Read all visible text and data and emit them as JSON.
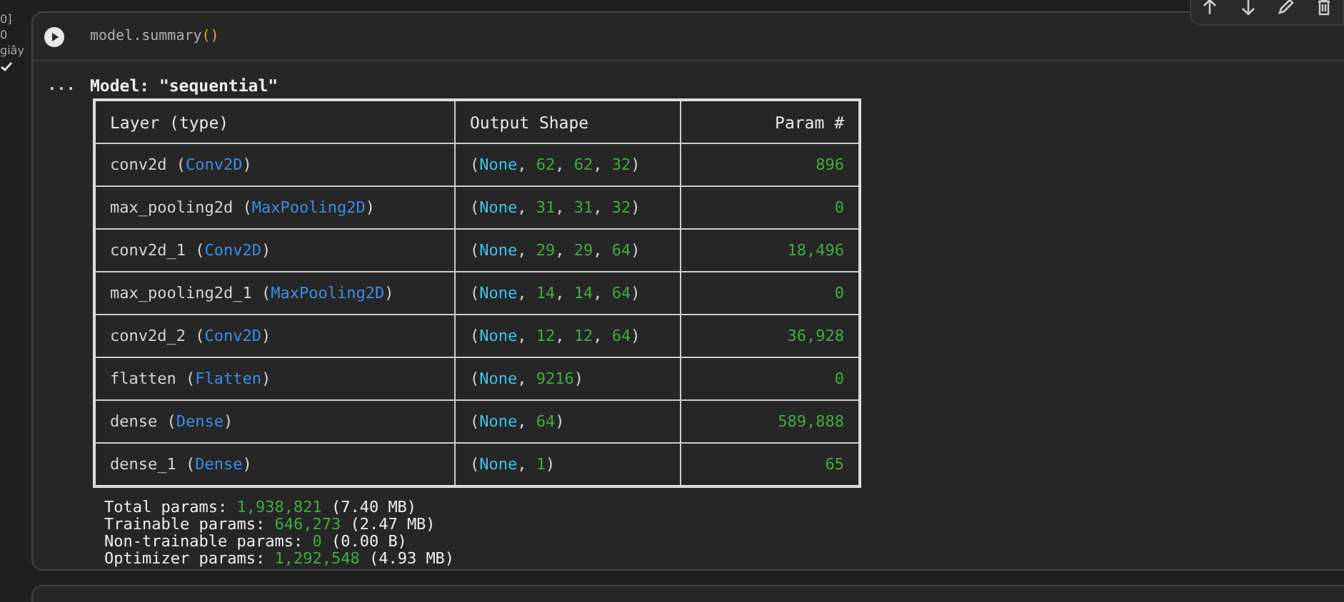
{
  "gutter": {
    "labels": [
      "0]",
      "0",
      "giây"
    ]
  },
  "cell": {
    "code": [
      {
        "kind": "fn",
        "text": "model.summary"
      },
      {
        "kind": "paren",
        "text": "()"
      }
    ],
    "output": {
      "prompt": "...",
      "title": "Model: \"sequential\"",
      "table": {
        "columns": [
          "Layer (type)",
          "Output Shape",
          "Param #"
        ],
        "rows": [
          {
            "layer": [
              {
                "kind": "t",
                "text": "conv2d ("
              },
              {
                "kind": "type",
                "text": "Conv2D"
              },
              {
                "kind": "t",
                "text": ")"
              }
            ],
            "shape": [
              {
                "kind": "t",
                "text": "("
              },
              {
                "kind": "none",
                "text": "None"
              },
              {
                "kind": "t",
                "text": ", "
              },
              {
                "kind": "num",
                "text": "62"
              },
              {
                "kind": "t",
                "text": ", "
              },
              {
                "kind": "num",
                "text": "62"
              },
              {
                "kind": "t",
                "text": ", "
              },
              {
                "kind": "num",
                "text": "32"
              },
              {
                "kind": "t",
                "text": ")"
              }
            ],
            "params": "896"
          },
          {
            "layer": [
              {
                "kind": "t",
                "text": "max_pooling2d ("
              },
              {
                "kind": "type",
                "text": "MaxPooling2D"
              },
              {
                "kind": "t",
                "text": ")"
              }
            ],
            "shape": [
              {
                "kind": "t",
                "text": "("
              },
              {
                "kind": "none",
                "text": "None"
              },
              {
                "kind": "t",
                "text": ", "
              },
              {
                "kind": "num",
                "text": "31"
              },
              {
                "kind": "t",
                "text": ", "
              },
              {
                "kind": "num",
                "text": "31"
              },
              {
                "kind": "t",
                "text": ", "
              },
              {
                "kind": "num",
                "text": "32"
              },
              {
                "kind": "t",
                "text": ")"
              }
            ],
            "params": "0"
          },
          {
            "layer": [
              {
                "kind": "t",
                "text": "conv2d_1 ("
              },
              {
                "kind": "type",
                "text": "Conv2D"
              },
              {
                "kind": "t",
                "text": ")"
              }
            ],
            "shape": [
              {
                "kind": "t",
                "text": "("
              },
              {
                "kind": "none",
                "text": "None"
              },
              {
                "kind": "t",
                "text": ", "
              },
              {
                "kind": "num",
                "text": "29"
              },
              {
                "kind": "t",
                "text": ", "
              },
              {
                "kind": "num",
                "text": "29"
              },
              {
                "kind": "t",
                "text": ", "
              },
              {
                "kind": "num",
                "text": "64"
              },
              {
                "kind": "t",
                "text": ")"
              }
            ],
            "params": "18,496"
          },
          {
            "layer": [
              {
                "kind": "t",
                "text": "max_pooling2d_1 ("
              },
              {
                "kind": "type",
                "text": "MaxPooling2D"
              },
              {
                "kind": "t",
                "text": ")"
              }
            ],
            "shape": [
              {
                "kind": "t",
                "text": "("
              },
              {
                "kind": "none",
                "text": "None"
              },
              {
                "kind": "t",
                "text": ", "
              },
              {
                "kind": "num",
                "text": "14"
              },
              {
                "kind": "t",
                "text": ", "
              },
              {
                "kind": "num",
                "text": "14"
              },
              {
                "kind": "t",
                "text": ", "
              },
              {
                "kind": "num",
                "text": "64"
              },
              {
                "kind": "t",
                "text": ")"
              }
            ],
            "params": "0"
          },
          {
            "layer": [
              {
                "kind": "t",
                "text": "conv2d_2 ("
              },
              {
                "kind": "type",
                "text": "Conv2D"
              },
              {
                "kind": "t",
                "text": ")"
              }
            ],
            "shape": [
              {
                "kind": "t",
                "text": "("
              },
              {
                "kind": "none",
                "text": "None"
              },
              {
                "kind": "t",
                "text": ", "
              },
              {
                "kind": "num",
                "text": "12"
              },
              {
                "kind": "t",
                "text": ", "
              },
              {
                "kind": "num",
                "text": "12"
              },
              {
                "kind": "t",
                "text": ", "
              },
              {
                "kind": "num",
                "text": "64"
              },
              {
                "kind": "t",
                "text": ")"
              }
            ],
            "params": "36,928"
          },
          {
            "layer": [
              {
                "kind": "t",
                "text": "flatten ("
              },
              {
                "kind": "type",
                "text": "Flatten"
              },
              {
                "kind": "t",
                "text": ")"
              }
            ],
            "shape": [
              {
                "kind": "t",
                "text": "("
              },
              {
                "kind": "none",
                "text": "None"
              },
              {
                "kind": "t",
                "text": ", "
              },
              {
                "kind": "num",
                "text": "9216"
              },
              {
                "kind": "t",
                "text": ")"
              }
            ],
            "params": "0"
          },
          {
            "layer": [
              {
                "kind": "t",
                "text": "dense ("
              },
              {
                "kind": "type",
                "text": "Dense"
              },
              {
                "kind": "t",
                "text": ")"
              }
            ],
            "shape": [
              {
                "kind": "t",
                "text": "("
              },
              {
                "kind": "none",
                "text": "None"
              },
              {
                "kind": "t",
                "text": ", "
              },
              {
                "kind": "num",
                "text": "64"
              },
              {
                "kind": "t",
                "text": ")"
              }
            ],
            "params": "589,888"
          },
          {
            "layer": [
              {
                "kind": "t",
                "text": "dense_1 ("
              },
              {
                "kind": "type",
                "text": "Dense"
              },
              {
                "kind": "t",
                "text": ")"
              }
            ],
            "shape": [
              {
                "kind": "t",
                "text": "("
              },
              {
                "kind": "none",
                "text": "None"
              },
              {
                "kind": "t",
                "text": ", "
              },
              {
                "kind": "num",
                "text": "1"
              },
              {
                "kind": "t",
                "text": ")"
              }
            ],
            "params": "65"
          }
        ]
      },
      "totals": [
        {
          "label": "Total params:",
          "value": "1,938,821",
          "size": "(7.40 MB)"
        },
        {
          "label": "Trainable params:",
          "value": "646,273",
          "size": "(2.47 MB)"
        },
        {
          "label": "Non-trainable params:",
          "value": "0",
          "size": "(0.00 B)"
        },
        {
          "label": "Optimizer params:",
          "value": "1,292,548",
          "size": "(4.93 MB)"
        }
      ]
    }
  }
}
